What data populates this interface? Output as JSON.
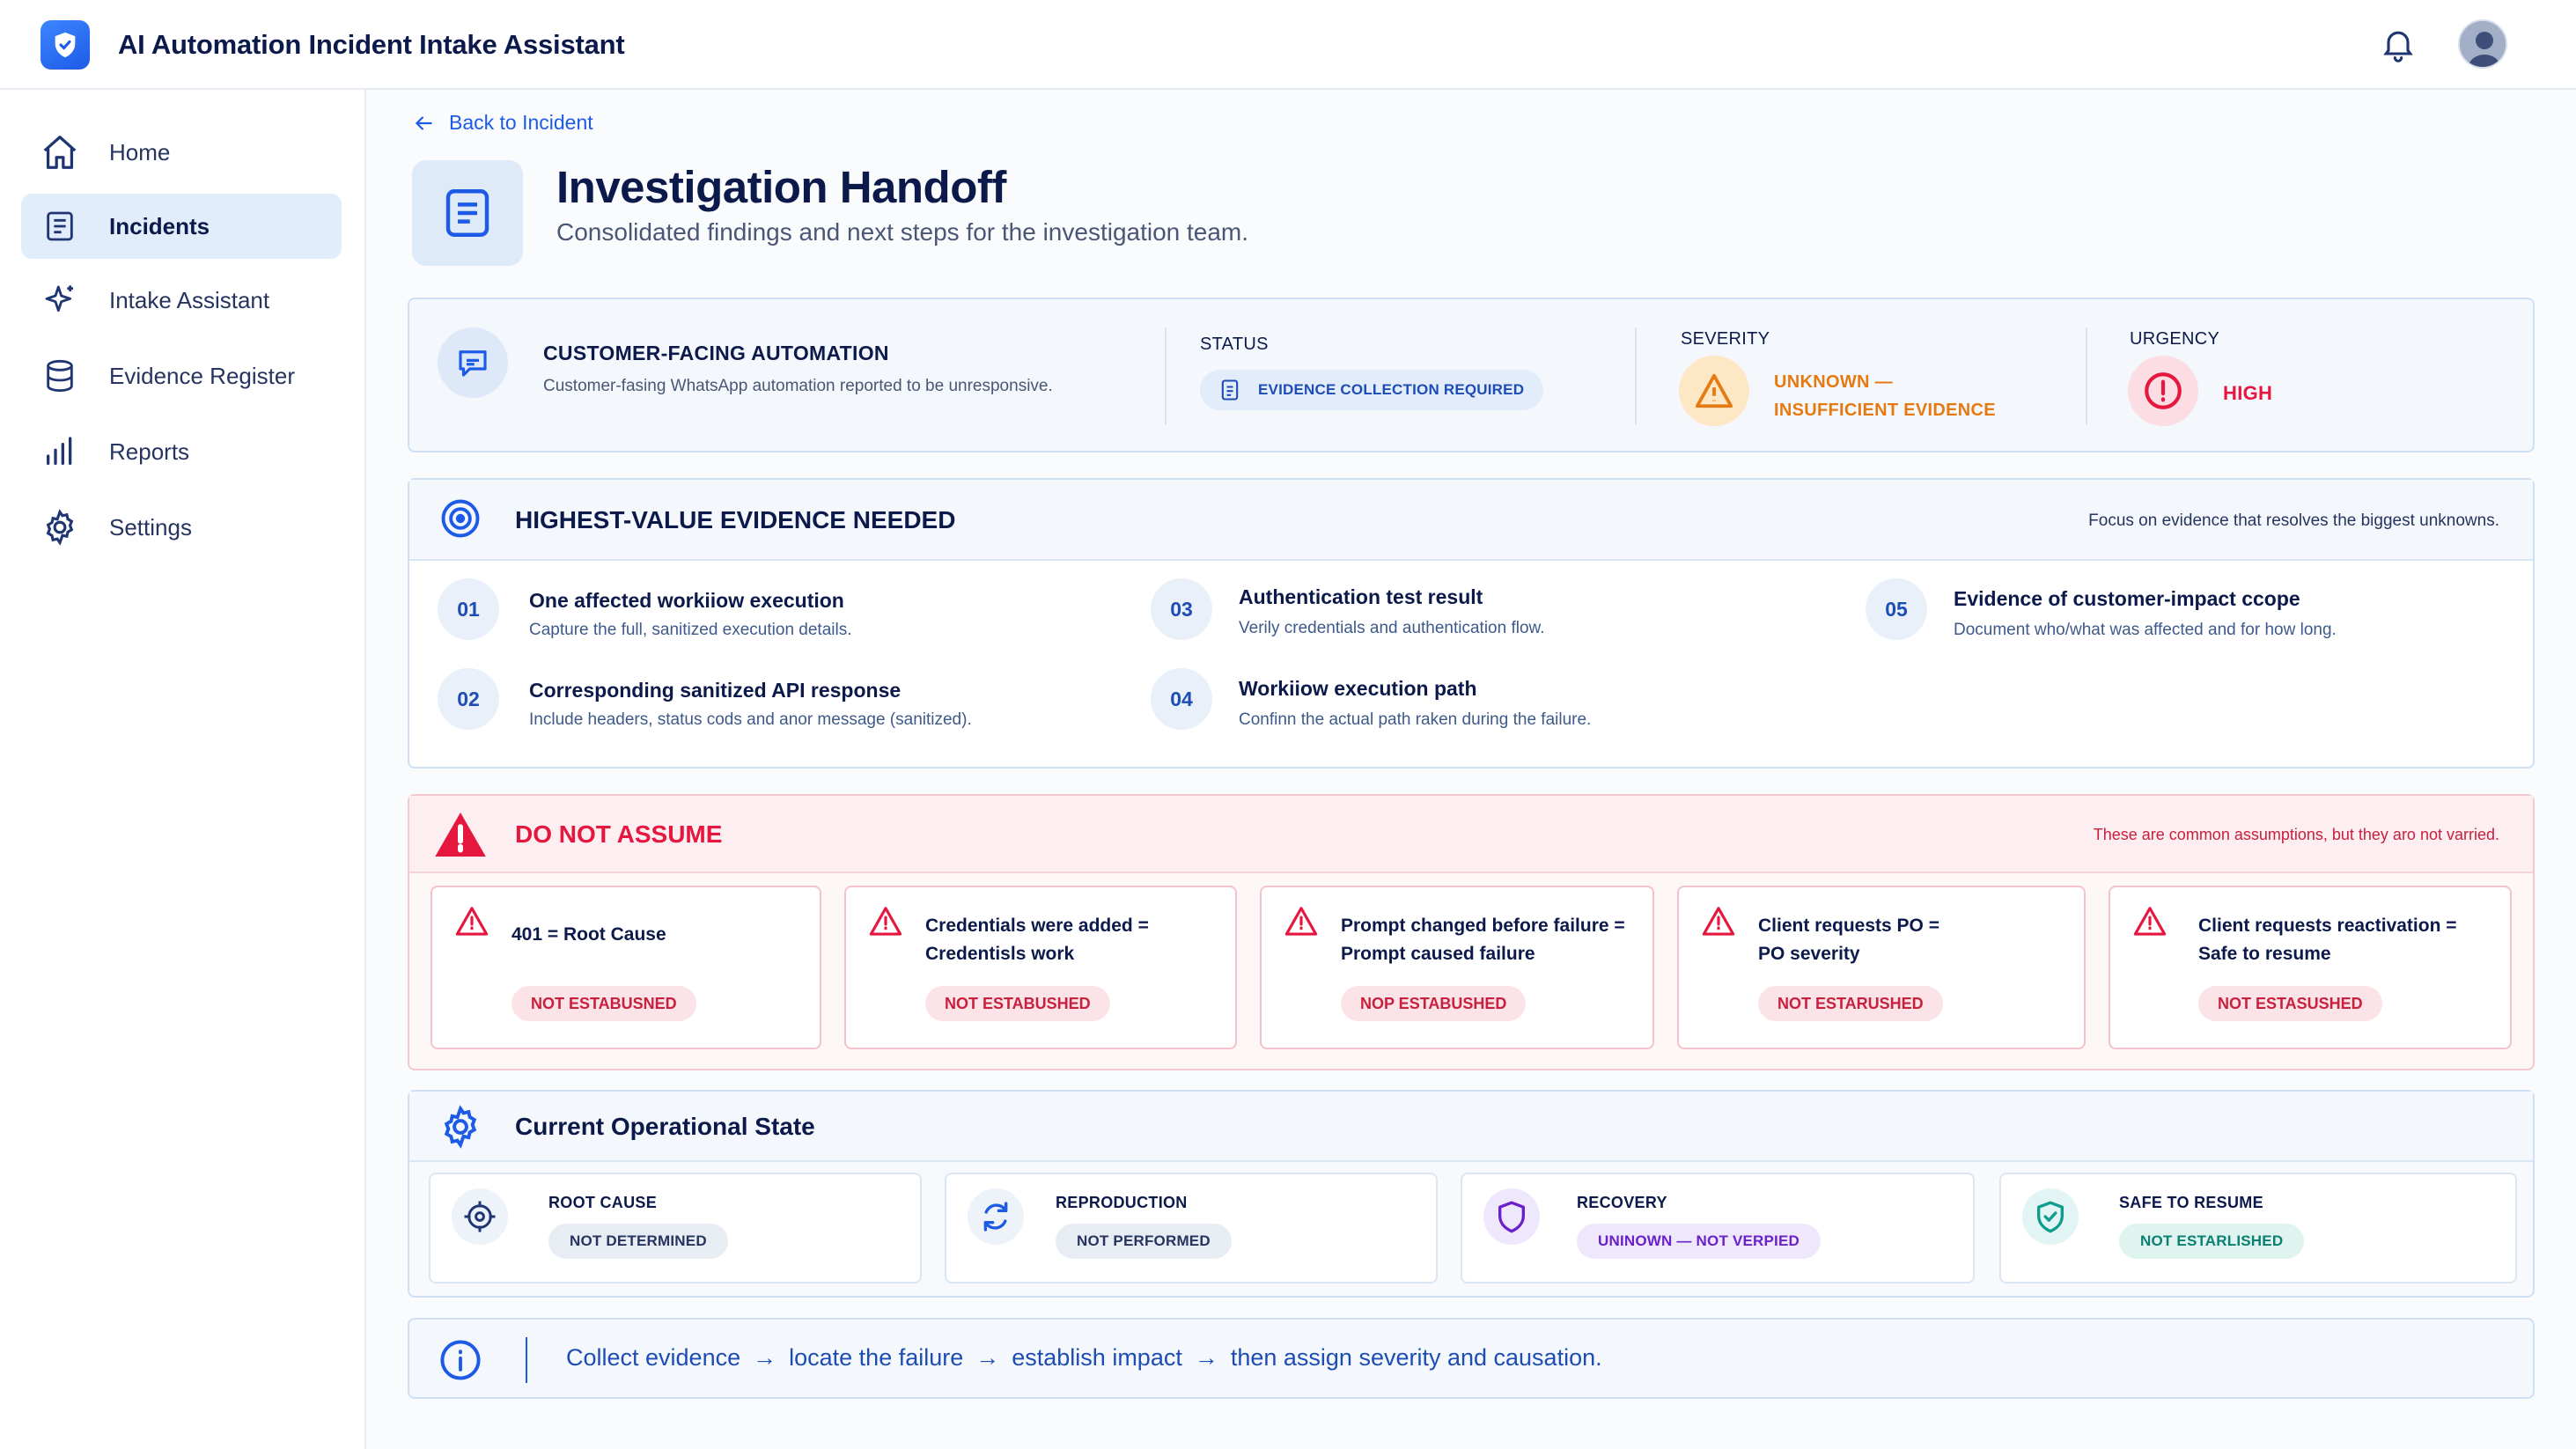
{
  "app": {
    "title": "AI Automation Incident Intake Assistant"
  },
  "nav": [
    {
      "label": "Home",
      "icon": "home-icon"
    },
    {
      "label": "Incidents",
      "icon": "document-icon",
      "active": true
    },
    {
      "label": "Intake Assistant",
      "icon": "sparkle-icon"
    },
    {
      "label": "Evidence Register",
      "icon": "database-icon"
    },
    {
      "label": "Reports",
      "icon": "bar-chart-icon"
    },
    {
      "label": "Settings",
      "icon": "gear-icon"
    }
  ],
  "page": {
    "back": "Back to Incident",
    "title": "Investigation Handoff",
    "subtitle": "Consolidated findings and next steps for the investigation team."
  },
  "summary": {
    "automation_label": "CUSTOMER-FACING AUTOMATION",
    "automation_desc": "Customer-fasing WhatsApp automation reported to be unresponsive.",
    "status_label": "STATUS",
    "status_value": "EVIDENCE COLLECTION REQUIRED",
    "severity_label": "SEVERITY",
    "severity_line1": "UNKNOWN —",
    "severity_line2": "INSUFFICIENT EVIDENCE",
    "urgency_label": "URGENCY",
    "urgency_value": "HIGH"
  },
  "evidence": {
    "title": "HIGHEST-VALUE EVIDENCE NEEDED",
    "note": "Focus on evidence that resolves the biggest unknowns.",
    "items": [
      {
        "num": "01",
        "title": "One affected workiiow execution",
        "desc": "Capture the full, sanitized execution details."
      },
      {
        "num": "02",
        "title": "Corresponding sanitized API response",
        "desc": "Include headers, status cods and anor message (sanitized)."
      },
      {
        "num": "03",
        "title": "Authentication test result",
        "desc": "Verily credentials and authentication flow."
      },
      {
        "num": "04",
        "title": "Workiiow execution path",
        "desc": "Confinn the actual path raken during the failure."
      },
      {
        "num": "05",
        "title": "Evidence of customer-impact ccope",
        "desc": "Document who/what was affected and for how long."
      }
    ]
  },
  "assume": {
    "title": "DO NOT ASSUME",
    "note": "These are common assumptions, but they aro not varried.",
    "items": [
      {
        "line1": "401 = Root Cause",
        "line2": "",
        "pill": "NOT ESTABUSNED"
      },
      {
        "line1": "Credentials were added =",
        "line2": "Credentisls work",
        "pill": "NOT ESTABUSHED"
      },
      {
        "line1": "Prompt changed before failure =",
        "line2": "Prompt caused failure",
        "pill": "NOP ESTABUSHED"
      },
      {
        "line1": "Client requests PO =",
        "line2": "PO severity",
        "pill": "NOT ESTARUSHED"
      },
      {
        "line1": "Client requests reactivation =",
        "line2": "Safe to resume",
        "pill": "NOT ESTASUSHED"
      }
    ]
  },
  "opstate": {
    "title": "Current Operational State",
    "items": [
      {
        "label": "ROOT CAUSE",
        "value": "NOT DETERMINED"
      },
      {
        "label": "REPRODUCTION",
        "value": "NOT PERFORMED"
      },
      {
        "label": "RECOVERY",
        "value": "UNINOWN — NOT VERPIED"
      },
      {
        "label": "SAFE TO RESUME",
        "value": "NOT ESTARLISHED"
      }
    ]
  },
  "footer": {
    "s1": "Collect evidence",
    "s2": "locate the failure",
    "s3": "establish impact",
    "s4": "then assign severity and causation.",
    "arrow": "→"
  },
  "colors": {
    "accent": "#1d5be6",
    "danger": "#e5173f",
    "warning": "#e67a12",
    "success": "#0e9c8c"
  }
}
